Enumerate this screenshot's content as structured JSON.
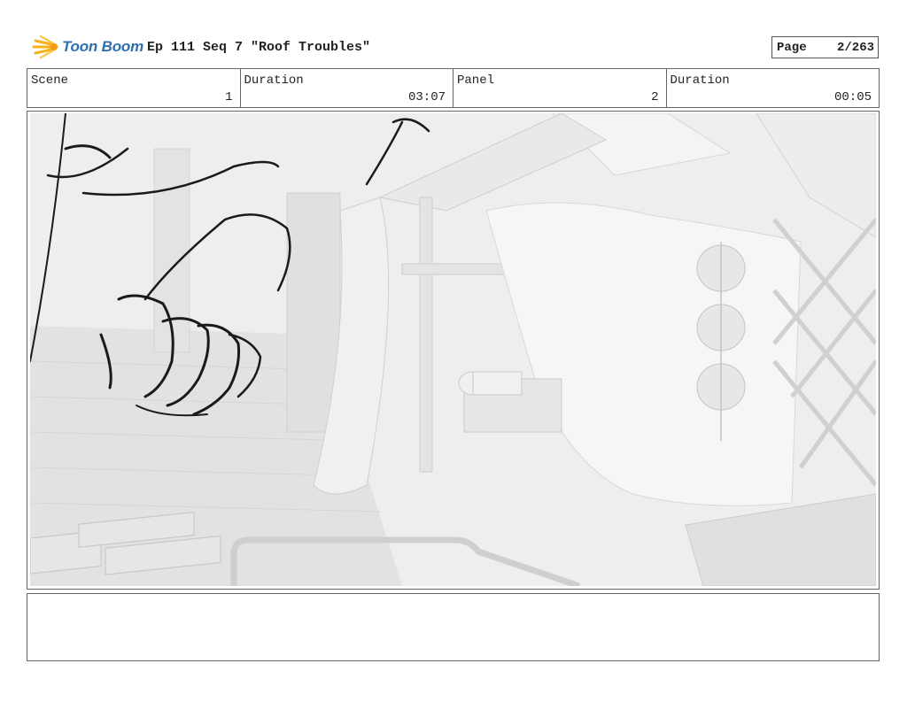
{
  "header": {
    "logo_text": "Toon Boom",
    "episode_title": "Ep 111 Seq 7 \"Roof Troubles\"",
    "page_label": "Page",
    "page_value": "2/263"
  },
  "info": {
    "scene_label": "Scene",
    "scene_value": "1",
    "scene_duration_label": "Duration",
    "scene_duration_value": "03:07",
    "panel_label": "Panel",
    "panel_value": "2",
    "panel_duration_label": "Duration",
    "panel_duration_value": "00:05"
  },
  "panel": {
    "icon": "storyboard-sketch-image"
  },
  "notes": {
    "text": ""
  }
}
